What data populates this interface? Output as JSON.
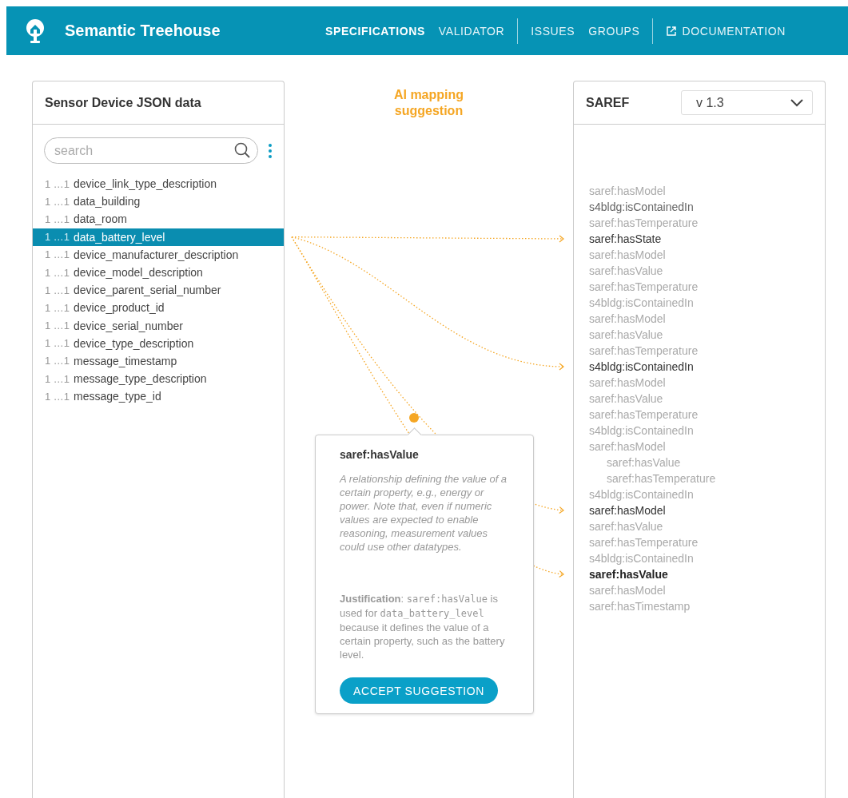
{
  "header": {
    "title": "Semantic Treehouse",
    "nav": [
      {
        "items": [
          {
            "label": "SPECIFICATIONS",
            "selected": true,
            "external": false
          },
          {
            "label": "VALIDATOR",
            "selected": false,
            "external": false
          }
        ]
      },
      {
        "items": [
          {
            "label": "ISSUES",
            "selected": false,
            "external": false
          },
          {
            "label": "GROUPS",
            "selected": false,
            "external": false
          }
        ]
      },
      {
        "items": [
          {
            "label": "DOCUMENTATION",
            "selected": false,
            "external": true
          }
        ]
      }
    ]
  },
  "source": {
    "title": "Sensor Device JSON data",
    "search": {
      "placeholder": "search"
    },
    "rows": [
      {
        "cardinality": "1 …1",
        "name": "device_link_type_description",
        "selected": false
      },
      {
        "cardinality": "1 …1",
        "name": "data_building",
        "selected": false
      },
      {
        "cardinality": "1 …1",
        "name": "data_room",
        "selected": false
      },
      {
        "cardinality": "1 …1",
        "name": "data_battery_level",
        "selected": true
      },
      {
        "cardinality": "1 …1",
        "name": "device_manufacturer_description",
        "selected": false
      },
      {
        "cardinality": "1 …1",
        "name": "device_model_description",
        "selected": false
      },
      {
        "cardinality": "1 …1",
        "name": "device_parent_serial_number",
        "selected": false
      },
      {
        "cardinality": "1 …1",
        "name": "device_product_id",
        "selected": false
      },
      {
        "cardinality": "1 …1",
        "name": "device_serial_number",
        "selected": false
      },
      {
        "cardinality": "1 …1",
        "name": "device_type_description",
        "selected": false
      },
      {
        "cardinality": "1 …1",
        "name": "message_timestamp",
        "selected": false
      },
      {
        "cardinality": "1 …1",
        "name": "message_type_description",
        "selected": false
      },
      {
        "cardinality": "1 …1",
        "name": "message_type_id",
        "selected": false
      }
    ]
  },
  "suggestion_title": "AI mapping suggestion",
  "popover": {
    "title": "saref:hasValue",
    "description": "A relationship defining the value of a certain property, e.g., energy or power. Note that, even if numeric values are expected to enable reasoning, measurement values could use other datatypes.",
    "justification": [
      {
        "kind": "label",
        "text": "Justification"
      },
      {
        "kind": "text",
        "text": ": "
      },
      {
        "kind": "code",
        "text": "saref:hasValue"
      },
      {
        "kind": "text",
        "text": " is used for "
      },
      {
        "kind": "code",
        "text": "data_battery_level"
      },
      {
        "kind": "text",
        "text": " because it defines the value of a certain property, such as the battery level."
      }
    ],
    "button": "ACCEPT SUGGESTION"
  },
  "target": {
    "title": "SAREF",
    "version": "v 1.3",
    "items": [
      {
        "label": "saref:hasModel",
        "kind": "dim"
      },
      {
        "label": "s4bldg:isContainedIn",
        "kind": "plain"
      },
      {
        "label": "saref:hasTemperature",
        "kind": "dim"
      },
      {
        "label": "saref:hasState",
        "kind": "mapped"
      },
      {
        "label": "saref:hasModel",
        "kind": "dim"
      },
      {
        "label": "saref:hasValue",
        "kind": "dim"
      },
      {
        "label": "saref:hasTemperature",
        "kind": "dim"
      },
      {
        "label": "s4bldg:isContainedIn",
        "kind": "dim"
      },
      {
        "label": "saref:hasModel",
        "kind": "dim"
      },
      {
        "label": "saref:hasValue",
        "kind": "dim"
      },
      {
        "label": "saref:hasTemperature",
        "kind": "dim"
      },
      {
        "label": "s4bldg:isContainedIn",
        "kind": "mapped"
      },
      {
        "label": "saref:hasModel",
        "kind": "dim"
      },
      {
        "label": "saref:hasValue",
        "kind": "dim"
      },
      {
        "label": "saref:hasTemperature",
        "kind": "dim"
      },
      {
        "label": "s4bldg:isContainedIn",
        "kind": "dim"
      },
      {
        "label": "saref:hasModel",
        "kind": "dim",
        "children": [
          {
            "label": "saref:hasValue",
            "kind": "dim"
          },
          {
            "label": "saref:hasTemperature",
            "kind": "dim"
          }
        ]
      },
      {
        "label": "s4bldg:isContainedIn",
        "kind": "dim"
      },
      {
        "label": "saref:hasModel",
        "kind": "mapped"
      },
      {
        "label": "saref:hasValue",
        "kind": "dim"
      },
      {
        "label": "saref:hasTemperature",
        "kind": "dim"
      },
      {
        "label": "s4bldg:isContainedIn",
        "kind": "dim"
      },
      {
        "label": "saref:hasValue",
        "kind": "suggested"
      },
      {
        "label": "saref:hasModel",
        "kind": "dim"
      },
      {
        "label": "saref:hasTimestamp",
        "kind": "dim"
      }
    ]
  }
}
